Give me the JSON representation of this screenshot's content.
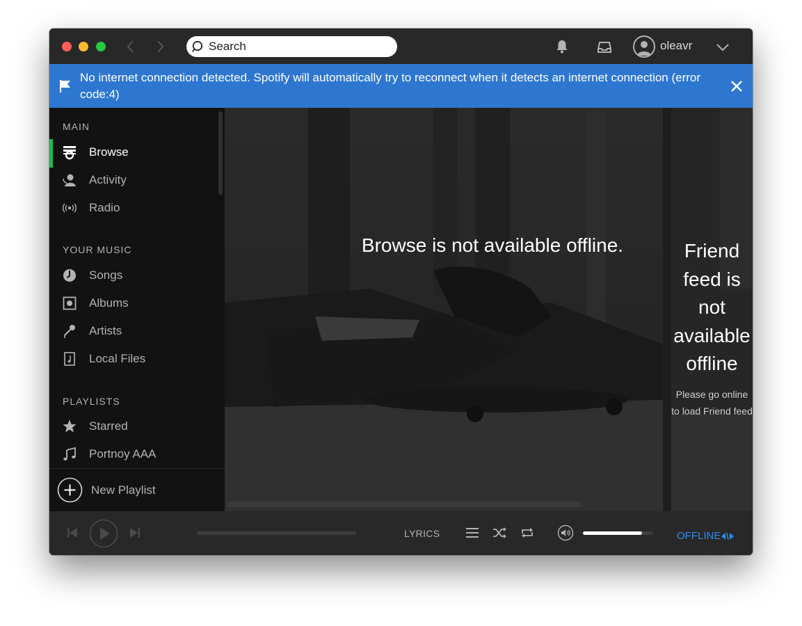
{
  "search": {
    "placeholder": "Search"
  },
  "user": {
    "name": "oleavr"
  },
  "banner": {
    "message": "No internet connection detected. Spotify will automatically try to reconnect when it detects an internet connection (error code:4)",
    "color": "#2e77d0"
  },
  "sidebar": {
    "main_title": "MAIN",
    "main_items": [
      {
        "label": "Browse",
        "icon": "browse-icon"
      },
      {
        "label": "Activity",
        "icon": "activity-icon"
      },
      {
        "label": "Radio",
        "icon": "radio-icon"
      }
    ],
    "music_title": "YOUR MUSIC",
    "music_items": [
      {
        "label": "Songs",
        "icon": "songs-icon"
      },
      {
        "label": "Albums",
        "icon": "albums-icon"
      },
      {
        "label": "Artists",
        "icon": "artists-icon"
      },
      {
        "label": "Local Files",
        "icon": "local-files-icon"
      }
    ],
    "playlists_title": "PLAYLISTS",
    "playlist_items": [
      {
        "label": "Starred",
        "icon": "star-icon"
      },
      {
        "label": "Portnoy AAA",
        "icon": "music-note-icon"
      }
    ],
    "new_playlist_label": "New Playlist",
    "active_item": "Browse",
    "active_color": "#1db954"
  },
  "main": {
    "offline_message": "Browse is not available offline."
  },
  "friend_feed": {
    "title": "Friend feed is not available offline",
    "subtitle": "Please go online to load Friend feed"
  },
  "player": {
    "lyrics_label": "LYRICS",
    "volume_level": 0.84,
    "offline_label": "OFFLINE",
    "offline_color": "#2e8bf0"
  }
}
